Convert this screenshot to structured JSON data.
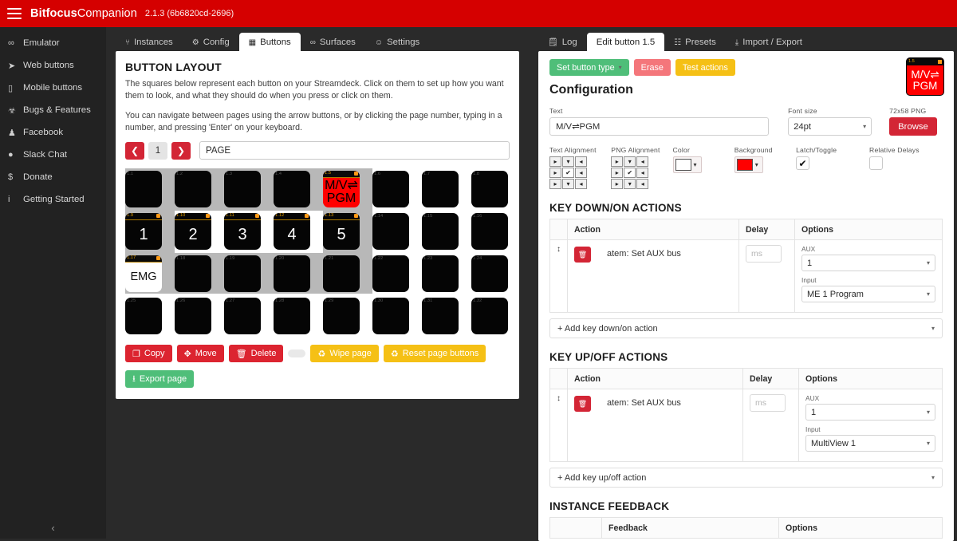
{
  "topbar": {
    "menu_icon": "hamburger-icon",
    "brand_bold": "Bitfocus",
    "brand_light": "Companion",
    "version": "2.1.3 (6b6820cd-2696)",
    "accent": "#d50000"
  },
  "sidebar": {
    "items": [
      {
        "icon": "goggles-icon",
        "glyph": "∞",
        "label": "Emulator"
      },
      {
        "icon": "cursor-icon",
        "glyph": "➤",
        "label": "Web buttons"
      },
      {
        "icon": "mobile-icon",
        "glyph": "▯",
        "label": "Mobile buttons"
      },
      {
        "icon": "bug-icon",
        "glyph": "☣",
        "label": "Bugs & Features"
      },
      {
        "icon": "people-icon",
        "glyph": "♟",
        "label": "Facebook"
      },
      {
        "icon": "chat-icon",
        "glyph": "●",
        "label": "Slack Chat"
      },
      {
        "icon": "dollar-icon",
        "glyph": "$",
        "label": "Donate"
      },
      {
        "icon": "info-icon",
        "glyph": "i",
        "label": "Getting Started"
      }
    ],
    "collapse_glyph": "‹"
  },
  "left": {
    "tabs": [
      {
        "glyph": "⑂",
        "label": "Instances",
        "active": false
      },
      {
        "glyph": "⚙",
        "label": "Config",
        "active": false
      },
      {
        "glyph": "▦",
        "label": "Buttons",
        "active": true
      },
      {
        "glyph": "∞",
        "label": "Surfaces",
        "active": false
      },
      {
        "glyph": "☺",
        "label": "Settings",
        "active": false
      }
    ],
    "title": "BUTTON LAYOUT",
    "paragraph1": "The squares below represent each button on your Streamdeck. Click on them to set up how you want them to look, and what they should do when you press or click on them.",
    "paragraph2": "You can navigate between pages using the arrow buttons, or by clicking the page number, typing in a number, and pressing 'Enter' on your keyboard.",
    "page": {
      "prev_glyph": "❮",
      "number": "1",
      "next_glyph": "❯",
      "name_value": "PAGE"
    },
    "grid": {
      "columns": 8,
      "rows": 4,
      "keys": [
        {
          "id": "1.1",
          "text": "",
          "style": "dark",
          "lit": false
        },
        {
          "id": "1.2",
          "text": "",
          "style": "dark",
          "lit": false
        },
        {
          "id": "1.3",
          "text": "",
          "style": "dark",
          "lit": false
        },
        {
          "id": "1.4",
          "text": "",
          "style": "dark",
          "lit": false
        },
        {
          "id": "1.5",
          "text": "M/V⇌ PGM",
          "style": "red",
          "lit": true
        },
        {
          "id": "1.6",
          "text": "",
          "style": "dark",
          "lit": false
        },
        {
          "id": "1.7",
          "text": "",
          "style": "dark",
          "lit": false
        },
        {
          "id": "1.8",
          "text": "",
          "style": "dark",
          "lit": false
        },
        {
          "id": "1.9",
          "text": "1",
          "style": "dark",
          "lit": true
        },
        {
          "id": "1.10",
          "text": "2",
          "style": "dark",
          "lit": true
        },
        {
          "id": "1.11",
          "text": "3",
          "style": "dark",
          "lit": true
        },
        {
          "id": "1.12",
          "text": "4",
          "style": "dark",
          "lit": true
        },
        {
          "id": "1.13",
          "text": "5",
          "style": "dark",
          "lit": true
        },
        {
          "id": "1.14",
          "text": "",
          "style": "dark",
          "lit": false
        },
        {
          "id": "1.15",
          "text": "",
          "style": "dark",
          "lit": false
        },
        {
          "id": "1.16",
          "text": "",
          "style": "dark",
          "lit": false
        },
        {
          "id": "1.17",
          "text": "EMG",
          "style": "white",
          "lit": true
        },
        {
          "id": "1.18",
          "text": "",
          "style": "dark",
          "lit": false
        },
        {
          "id": "1.19",
          "text": "",
          "style": "dark",
          "lit": false
        },
        {
          "id": "1.20",
          "text": "",
          "style": "dark",
          "lit": false
        },
        {
          "id": "1.21",
          "text": "",
          "style": "dark",
          "lit": false
        },
        {
          "id": "1.22",
          "text": "",
          "style": "dark",
          "lit": false
        },
        {
          "id": "1.23",
          "text": "",
          "style": "dark",
          "lit": false
        },
        {
          "id": "1.24",
          "text": "",
          "style": "dark",
          "lit": false
        },
        {
          "id": "1.25",
          "text": "",
          "style": "dark",
          "lit": false
        },
        {
          "id": "1.26",
          "text": "",
          "style": "dark",
          "lit": false
        },
        {
          "id": "1.27",
          "text": "",
          "style": "dark",
          "lit": false
        },
        {
          "id": "1.28",
          "text": "",
          "style": "dark",
          "lit": false
        },
        {
          "id": "1.29",
          "text": "",
          "style": "dark",
          "lit": false
        },
        {
          "id": "1.30",
          "text": "",
          "style": "dark",
          "lit": false
        },
        {
          "id": "1.31",
          "text": "",
          "style": "dark",
          "lit": false
        },
        {
          "id": "1.32",
          "text": "",
          "style": "dark",
          "lit": false
        }
      ]
    },
    "actions": [
      {
        "key": "copy",
        "glyph": "❐",
        "label": "Copy",
        "color": "red"
      },
      {
        "key": "move",
        "glyph": "✥",
        "label": "Move",
        "color": "red"
      },
      {
        "key": "delete",
        "glyph": "🗑",
        "label": "Delete",
        "color": "red"
      }
    ],
    "page_actions": [
      {
        "key": "wipe",
        "glyph": "♻",
        "label": "Wipe page",
        "color": "yellow"
      },
      {
        "key": "reset",
        "glyph": "♻",
        "label": "Reset page buttons",
        "color": "yellow"
      }
    ],
    "export": {
      "glyph": "⭳",
      "label": "Export page",
      "color": "green"
    }
  },
  "right": {
    "tabs": [
      {
        "glyph": "🗒",
        "label": "Log",
        "active": false
      },
      {
        "glyph": "",
        "label": "Edit button 1.5",
        "active": true
      },
      {
        "glyph": "☷",
        "label": "Presets",
        "active": false
      },
      {
        "glyph": "⤓",
        "label": "Import / Export",
        "active": false
      }
    ],
    "toolbar": [
      {
        "key": "set-button-type",
        "label": "Set button type",
        "caret": "▾",
        "color": "green"
      },
      {
        "key": "erase",
        "label": "Erase",
        "caret": "",
        "color": "salmon"
      },
      {
        "key": "test-actions",
        "label": "Test actions",
        "caret": "",
        "color": "amber"
      }
    ],
    "preview": {
      "id": "1.5",
      "line1": "M/V⇌",
      "line2": "PGM",
      "bg": "#ff0000",
      "fg": "#ffffff"
    },
    "config_title": "Configuration",
    "fields": {
      "text_label": "Text",
      "text_value": "M/V⇌PGM",
      "font_label": "Font size",
      "font_value": "24pt",
      "png_label": "72x58 PNG",
      "browse_label": "Browse"
    },
    "alignments": {
      "text_label": "Text Alignment",
      "text_selected": 4,
      "png_label": "PNG Alignment",
      "png_selected": 4,
      "color_label": "Color",
      "color_value": "#ffffff",
      "background_label": "Background",
      "background_value": "#ff0000",
      "latch_label": "Latch/Toggle",
      "latch_checked": true,
      "latch_glyph": "✔",
      "relative_label": "Relative Delays",
      "relative_checked": false
    },
    "keydown": {
      "title": "KEY DOWN/ON ACTIONS",
      "headers": [
        "",
        "Action",
        "Delay",
        "Options"
      ],
      "rows": [
        {
          "handle": "↕",
          "delete_glyph": "🗑",
          "action": "atem: Set AUX bus",
          "delay_placeholder": "ms",
          "options": [
            {
              "label": "AUX",
              "value": "1"
            },
            {
              "label": "Input",
              "value": "ME 1 Program"
            }
          ]
        }
      ],
      "add_label": "+ Add key down/on action",
      "add_caret": "▾"
    },
    "keyup": {
      "title": "KEY UP/OFF ACTIONS",
      "headers": [
        "",
        "Action",
        "Delay",
        "Options"
      ],
      "rows": [
        {
          "handle": "↕",
          "delete_glyph": "🗑",
          "action": "atem: Set AUX bus",
          "delay_placeholder": "ms",
          "options": [
            {
              "label": "AUX",
              "value": "1"
            },
            {
              "label": "Input",
              "value": "MultiView 1"
            }
          ]
        }
      ],
      "add_label": "+ Add key up/off action",
      "add_caret": "▾"
    },
    "feedback": {
      "title": "INSTANCE FEEDBACK",
      "headers": [
        "",
        "Feedback",
        "Options"
      ]
    }
  }
}
